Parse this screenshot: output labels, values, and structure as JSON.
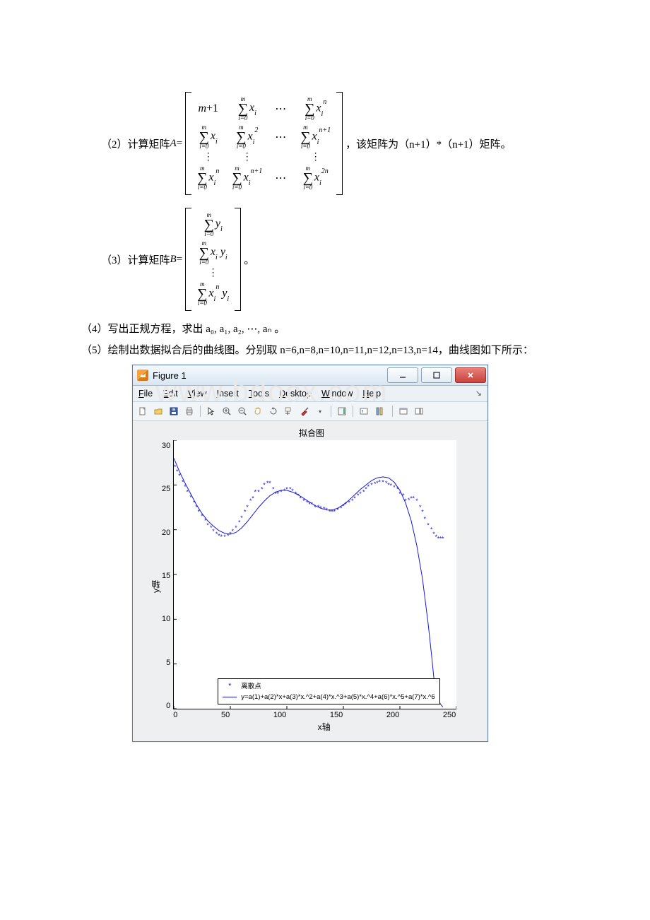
{
  "watermark": "www.bdocx.com",
  "eq2": {
    "label_pre": "（2）计算矩阵 ",
    "var": "A",
    "eq": " = ",
    "label_post": "，该矩阵为（n+1）*（n+1）矩阵。"
  },
  "eq3": {
    "label_pre": "（3）计算矩阵 ",
    "var": "B",
    "eq": " = ",
    "label_post": "。"
  },
  "para4": "（4）写出正规方程，求出 a₀, a₁, a₂, ⋯, aₙ 。",
  "para5": "（5）绘制出数据拟合后的曲线图。分别取 n=6,n=8,n=10,n=11,n=12,n=13,n=14，曲线图如下所示：",
  "figure": {
    "title": "Figure 1",
    "menus": [
      "File",
      "Edit",
      "View",
      "Insert",
      "Tools",
      "Desktop",
      "Window",
      "Help"
    ],
    "chart_title": "拟合图",
    "ylabel": "y轴",
    "xlabel": "x轴",
    "yticks": [
      "30",
      "25",
      "20",
      "15",
      "10",
      "5",
      "0"
    ],
    "xticks": [
      "0",
      "50",
      "100",
      "150",
      "200",
      "250"
    ],
    "legend1": "离散点",
    "legend2": "y=a(1)+a(2)*x+a(3)*x.^2+a(4)*x.^3+a(5)*x.^4+a(6)*x.^5+a(7)*x.^6"
  },
  "chart_data": {
    "type": "line",
    "title": "拟合图",
    "xlabel": "x轴",
    "ylabel": "y轴",
    "xlim": [
      0,
      250
    ],
    "ylim": [
      0,
      30
    ],
    "series": [
      {
        "name": "离散点",
        "type": "scatter",
        "x": [
          1,
          3,
          5,
          8,
          10,
          12,
          15,
          18,
          20,
          22,
          25,
          28,
          30,
          33,
          35,
          38,
          40,
          42,
          45,
          48,
          50,
          52,
          55,
          58,
          60,
          63,
          65,
          68,
          70,
          72,
          75,
          78,
          80,
          83,
          85,
          88,
          90,
          92,
          95,
          98,
          100,
          103,
          105,
          108,
          110,
          112,
          115,
          118,
          120,
          122,
          125,
          128,
          130,
          133,
          135,
          138,
          140,
          142,
          145,
          148,
          150,
          152,
          155,
          158,
          160,
          163,
          165,
          168,
          170,
          172,
          175,
          178,
          180,
          182,
          185,
          188,
          190,
          192,
          195,
          198,
          200,
          203,
          205,
          208,
          210,
          212,
          215,
          218,
          220,
          222,
          225,
          228,
          230,
          232,
          234,
          236,
          238
        ],
        "y": [
          27,
          26.5,
          26,
          25.3,
          24.8,
          24.2,
          23.6,
          23,
          22.5,
          22,
          21.5,
          21,
          20.5,
          20.2,
          19.8,
          19.5,
          19.3,
          19.2,
          19.2,
          19.3,
          19.5,
          19.8,
          20.2,
          20.8,
          21.3,
          22,
          22.5,
          23.2,
          23.5,
          24.2,
          24.2,
          24.5,
          25,
          25.2,
          25.2,
          24.5,
          24,
          24,
          24.2,
          24.3,
          24.5,
          24.5,
          24.3,
          24,
          23.8,
          23.5,
          23.2,
          23,
          22.8,
          22.8,
          22.5,
          22.5,
          22.4,
          22.3,
          22.2,
          22,
          22,
          22,
          22.2,
          22.4,
          22.6,
          22.8,
          23,
          23.2,
          23.5,
          23.8,
          24,
          24.2,
          24.5,
          24.8,
          25,
          25.1,
          25.2,
          25.3,
          25.3,
          25.2,
          25,
          24.9,
          24.7,
          24.5,
          24,
          23.8,
          23.2,
          23.3,
          23.5,
          23.5,
          23.2,
          22.5,
          22,
          21.2,
          20.5,
          20,
          19.5,
          19.2,
          19,
          19,
          19
        ]
      },
      {
        "name": "y=a(1)+a(2)*x+a(3)*x.^2+a(4)*x.^3+a(5)*x.^4+a(6)*x.^5+a(7)*x.^6",
        "type": "line",
        "x": [
          0,
          5,
          10,
          15,
          20,
          25,
          30,
          35,
          40,
          45,
          50,
          55,
          60,
          65,
          70,
          75,
          80,
          85,
          90,
          95,
          100,
          105,
          110,
          115,
          120,
          125,
          130,
          135,
          140,
          145,
          150,
          155,
          160,
          165,
          170,
          175,
          180,
          185,
          190,
          195,
          200,
          205,
          210,
          215,
          220,
          225,
          228,
          230,
          232,
          234,
          236,
          238
        ],
        "y": [
          28,
          26.5,
          25.2,
          24,
          22.8,
          21.8,
          21,
          20.4,
          19.9,
          19.6,
          19.5,
          19.7,
          20.2,
          20.9,
          21.7,
          22.5,
          23.2,
          23.8,
          24.2,
          24.4,
          24.4,
          24.2,
          23.9,
          23.5,
          23.1,
          22.7,
          22.4,
          22.2,
          22.2,
          22.4,
          22.8,
          23.3,
          23.9,
          24.5,
          25,
          25.5,
          25.8,
          25.9,
          25.8,
          25.3,
          24.4,
          23,
          21,
          18.2,
          14.5,
          9.5,
          6,
          3.5,
          2,
          1,
          0.5,
          0.2
        ]
      }
    ]
  }
}
